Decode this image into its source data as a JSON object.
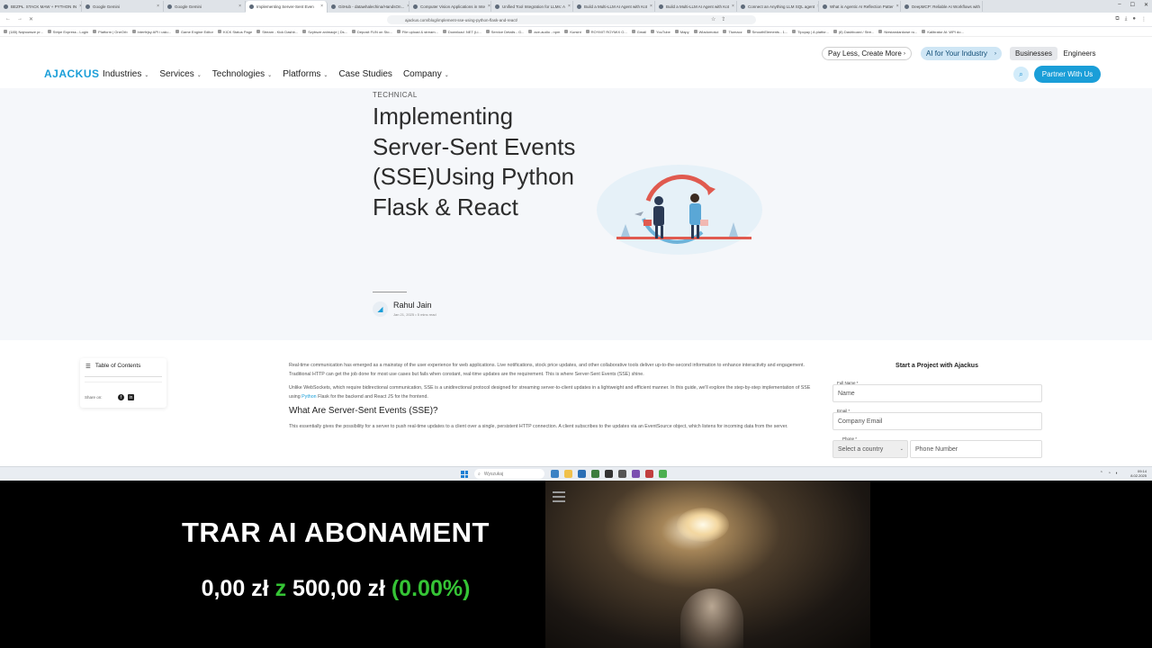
{
  "browser": {
    "tabs": [
      {
        "title": "BEZPŁ. STACK MAW + PYTHON IN"
      },
      {
        "title": "Google Gemini"
      },
      {
        "title": "Google Gemini"
      },
      {
        "title": "Implementing Server-Sent Even",
        "active": true
      },
      {
        "title": "GitHub - datawhalechina/HandsOn..."
      },
      {
        "title": "Computer Vision Applications in Inte"
      },
      {
        "title": "Unified Tool Integration for LLMs: A"
      },
      {
        "title": "Build a Multi-LLM AI Agent with Kot"
      },
      {
        "title": "Build a Multi-LLM AI Agent with Kot"
      },
      {
        "title": "Connect an Anything LLM SQL agent"
      },
      {
        "title": "What is Agentic AI Reflection Patter"
      },
      {
        "title": "DeepMCP: Reliable AI Workflows with"
      }
    ],
    "url": "ajackus.com/blog/implement-sse-using-python-flask-and-react/",
    "bookmarks": [
      "(185) Najnowsze pr...",
      "Stripe Express - Login",
      "Platform | OneOrb",
      "Interfejsy API i usłu...",
      "Game Engine Editor",
      "KICK Status Page",
      "Stream - Kick Dashb...",
      "Szybsze animacje | Ds...",
      "Deposit FUN on Sto...",
      "File upload & stream...",
      "Download .NET (Li...",
      "Service Details - G...",
      "ace-audio - npm",
      "Kursint",
      "ROYMIT ROYMIX O...",
      "Gmail",
      "YouTube",
      "Mapy",
      "Wiadomości",
      "Tłumacz",
      "SmoothElements - 1...",
      "Tipcpay | A platfor...",
      "(8) Dashboard / Stre...",
      "Niestandardowe ro...",
      "Kalibrator AI: WPI do..."
    ]
  },
  "site": {
    "logo": "AJACKUS",
    "menu": [
      "Industries",
      "Services",
      "Technologies",
      "Platforms",
      "Case Studies",
      "Company"
    ],
    "menu_has_caret": [
      true,
      true,
      true,
      true,
      false,
      true
    ],
    "pay_less": "Pay Less, Create More",
    "ai_industry": "AI for Your Industry",
    "businesses": "Businesses",
    "engineers": "Engineers",
    "partner": "Partner With Us"
  },
  "hero": {
    "eyebrow": "TECHNICAL",
    "title": "Implementing Server-Sent Events (SSE)Using Python Flask & React",
    "author": "Rahul Jain",
    "meta": "Jan 21, 2025  •  5 mins read"
  },
  "toc": {
    "title": "Table of Contents",
    "share": "Share on:"
  },
  "article": {
    "p1": "Real-time communication has emerged as a mainstay of the user experience for web applications. Live notifications, stock price updates, and other collaborative tools deliver up-to-the-second information to enhance interactivity and engagement. Traditional HTTP can get the job done for most use cases but fails when constant, real-time updates are the requirement. This is where Server-Sent Events (SSE) shine.",
    "p2a": "Unlike WebSockets, which require bidirectional communication, SSE is a unidirectional protocol designed for streaming server-to-client updates in a lightweight and efficient manner. In this guide, we'll explore the step-by-step implementation of SSE using ",
    "p2link": "Python",
    "p2b": " Flask for the backend and React JS for the frontend.",
    "h2": "What Are Server-Sent Events (SSE)?",
    "p3": "This essentially gives the possibility for a server to push real-time updates to a client over a single, persistent HTTP connection. A client subscribes to the updates via an EventSource object, which listens for incoming data from the server."
  },
  "form": {
    "title": "Start a Project with Ajackus",
    "name_label": "Full Name *",
    "name_ph": "Name",
    "email_label": "Email *",
    "email_ph": "Company Email",
    "phone_label": "Phone *",
    "country_ph": "Select a country",
    "phone_ph": "Phone Number"
  },
  "taskbar": {
    "search": "Wyszukaj",
    "time": "09:14",
    "date": "8.02.2025"
  },
  "overlay": {
    "title": "TRAR AI ABONAMENT",
    "current": "0,00 zł",
    "mid": "z",
    "goal": "500,00 zł",
    "percent": "(0.00%)"
  }
}
